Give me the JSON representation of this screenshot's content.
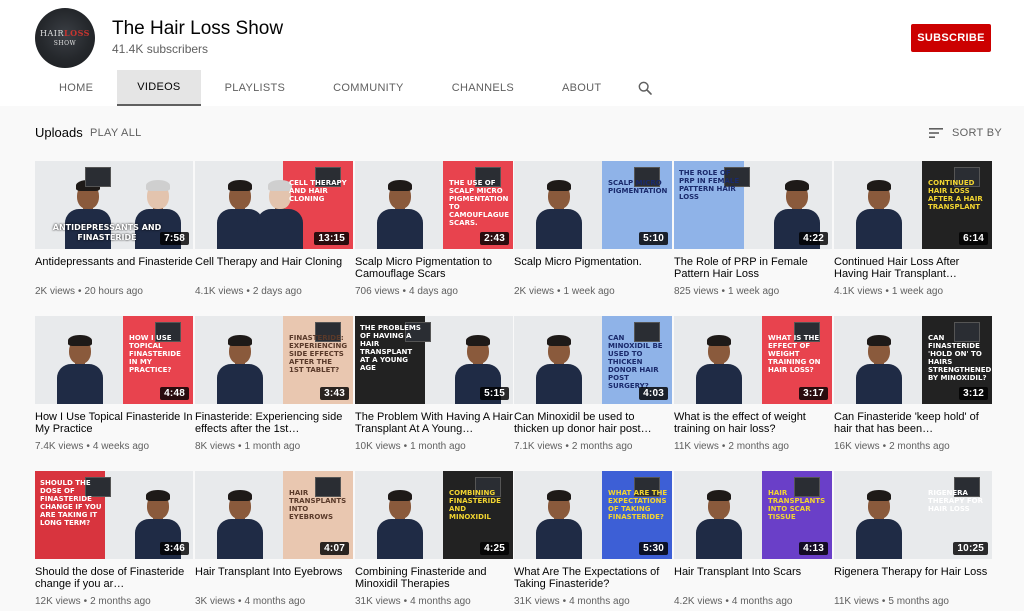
{
  "channel": {
    "title": "The Hair Loss Show",
    "subscribers": "41.4K subscribers",
    "subscribe_label": "SUBSCRIBE",
    "avatar_logo_top": "HAIR",
    "avatar_logo_accent": "LOSS",
    "avatar_logo_bottom": "SHOW",
    "brand_color": "#cc0000"
  },
  "tabs": [
    {
      "label": "HOME",
      "active": false
    },
    {
      "label": "VIDEOS",
      "active": true
    },
    {
      "label": "PLAYLISTS",
      "active": false
    },
    {
      "label": "COMMUNITY",
      "active": false
    },
    {
      "label": "CHANNELS",
      "active": false
    },
    {
      "label": "ABOUT",
      "active": false
    }
  ],
  "search_icon": "search-icon",
  "uploads": {
    "title": "Uploads",
    "play_all_label": "PLAY ALL",
    "sort_label": "SORT BY",
    "sort_icon": "sort-icon"
  },
  "videos": [
    {
      "title": "Antidepressants and Finasteride",
      "views": "2K views",
      "age": "20 hours ago",
      "duration": "7:58",
      "thumb_text": "ANTIDEPRESSANTS AND FINASTERIDE",
      "thumb_bg": "#d8dde2",
      "text_color": "#ffffff"
    },
    {
      "title": "Cell Therapy and Hair Cloning",
      "views": "4.1K views",
      "age": "2 days ago",
      "duration": "13:15",
      "thumb_text": "CELL THERAPY AND HAIR CLONING",
      "thumb_bg": "#e8434e",
      "text_color": "#ffffff"
    },
    {
      "title": "Scalp Micro Pigmentation to Camouflage Scars",
      "views": "706 views",
      "age": "4 days ago",
      "duration": "2:43",
      "thumb_text": "THE USE OF SCALP MICRO PIGMENTATION TO CAMOUFLAGUE SCARS.",
      "thumb_bg": "#e8434e",
      "text_color": "#ffffff"
    },
    {
      "title": "Scalp Micro Pigmentation.",
      "views": "2K views",
      "age": "1 week ago",
      "duration": "5:10",
      "thumb_text": "SCALP MICRO PIGMENTATION",
      "thumb_bg": "#8fb3e8",
      "text_color": "#1a2a6c"
    },
    {
      "title": "The Role of PRP in Female Pattern Hair Loss",
      "views": "825 views",
      "age": "1 week ago",
      "duration": "4:22",
      "thumb_text": "THE ROLE OF PRP IN FEMALE PATTERN HAIR LOSS",
      "thumb_bg": "#8fb3e8",
      "text_color": "#1a2a6c"
    },
    {
      "title": "Continued Hair Loss After Having Hair Transplant…",
      "views": "4.1K views",
      "age": "1 week ago",
      "duration": "6:14",
      "thumb_text": "CONTINUED HAIR LOSS AFTER A HAIR TRANSPLANT",
      "thumb_bg": "#222222",
      "text_color": "#f2d531"
    },
    {
      "title": "How I Use Topical Finasteride In My Practice",
      "views": "7.4K views",
      "age": "4 weeks ago",
      "duration": "4:48",
      "thumb_text": "HOW I USE TOPICAL FINASTERIDE IN MY PRACTICE?",
      "thumb_bg": "#e8434e",
      "text_color": "#ffffff"
    },
    {
      "title": "Finasteride: Experiencing side effects after the 1st…",
      "views": "8K views",
      "age": "1 month ago",
      "duration": "3:43",
      "thumb_text": "FINASTERIDE: EXPERIENCING SIDE EFFECTS AFTER THE 1ST TABLET?",
      "thumb_bg": "#e9c7b0",
      "text_color": "#5a3a2a"
    },
    {
      "title": "The Problem With Having A Hair Transplant At A Young…",
      "views": "10K views",
      "age": "1 month ago",
      "duration": "5:15",
      "thumb_text": "THE PROBLEMS OF HAVING A HAIR TRANSPLANT AT A YOUNG AGE",
      "thumb_bg": "#222222",
      "text_color": "#ffffff"
    },
    {
      "title": "Can Minoxidil be used to thicken up donor hair post…",
      "views": "7.1K views",
      "age": "2 months ago",
      "duration": "4:03",
      "thumb_text": "CAN MINOXIDIL BE USED TO THICKEN DONOR HAIR POST SURGERY?",
      "thumb_bg": "#8fb3e8",
      "text_color": "#1a2a6c"
    },
    {
      "title": "What is the effect of weight training on hair loss?",
      "views": "11K views",
      "age": "2 months ago",
      "duration": "3:17",
      "thumb_text": "WHAT IS THE EFFECT OF WEIGHT TRAINING ON HAIR LOSS?",
      "thumb_bg": "#e8434e",
      "text_color": "#ffffff"
    },
    {
      "title": "Can Finasteride 'keep hold' of hair that has been…",
      "views": "16K views",
      "age": "2 months ago",
      "duration": "3:12",
      "thumb_text": "CAN FINASTERIDE 'HOLD ON' TO HAIRS STRENGTHENED BY MINOXIDIL?",
      "thumb_bg": "#222222",
      "text_color": "#ffffff"
    },
    {
      "title": "Should the dose of Finasteride change if you ar…",
      "views": "12K views",
      "age": "2 months ago",
      "duration": "3:46",
      "thumb_text": "SHOULD THE DOSE OF FINASTERIDE CHANGE IF YOU ARE TAKING IT LONG TERM?",
      "thumb_bg": "#d8343e",
      "text_color": "#ffffff"
    },
    {
      "title": "Hair Transplant Into Eyebrows",
      "views": "3K views",
      "age": "4 months ago",
      "duration": "4:07",
      "thumb_text": "HAIR TRANSPLANTS INTO EYEBROWS",
      "thumb_bg": "#e9c7b0",
      "text_color": "#5a3a2a"
    },
    {
      "title": "Combining Finasteride and Minoxidil Therapies",
      "views": "31K views",
      "age": "4 months ago",
      "duration": "4:25",
      "thumb_text": "COMBINING FINASTERIDE AND MINOXIDIL",
      "thumb_bg": "#222222",
      "text_color": "#f2d531"
    },
    {
      "title": "What Are The Expectations of Taking Finasteride?",
      "views": "31K views",
      "age": "4 months ago",
      "duration": "5:30",
      "thumb_text": "WHAT ARE THE EXPECTATIONS OF TAKING FINASTERIDE?",
      "thumb_bg": "#3d5fd6",
      "text_color": "#f2d531"
    },
    {
      "title": "Hair Transplant Into Scars",
      "views": "4.2K views",
      "age": "4 months ago",
      "duration": "4:13",
      "thumb_text": "HAIR TRANSPLANTS INTO SCAR TISSUE",
      "thumb_bg": "#6a3fc8",
      "text_color": "#f2d531"
    },
    {
      "title": "Rigenera Therapy for Hair Loss",
      "views": "11K views",
      "age": "5 months ago",
      "duration": "10:25",
      "thumb_text": "RIGENERA THERAPY FOR HAIR LOSS",
      "thumb_bg": "#8fb3e8",
      "text_color": "#ffffff"
    }
  ]
}
